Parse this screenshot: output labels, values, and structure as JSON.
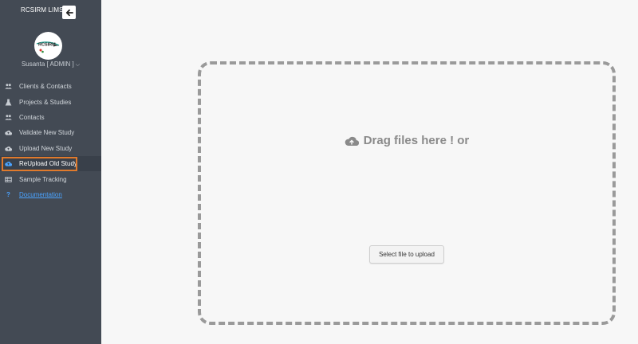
{
  "sidebar": {
    "brand": "RCSIRM LIMS",
    "user": "Susanta [ ADMIN ]",
    "user_caret": "⌵",
    "avatar_text": "RCSIRM",
    "items": [
      {
        "label": "Clients & Contacts",
        "icon": "users-icon"
      },
      {
        "label": "Projects & Studies",
        "icon": "flask-icon"
      },
      {
        "label": "Contacts",
        "icon": "users-icon"
      },
      {
        "label": "Validate New Study",
        "icon": "cloud-upload-icon"
      },
      {
        "label": "Upload New Study",
        "icon": "cloud-upload-icon"
      },
      {
        "label": "ReUpload Old Study",
        "icon": "cloud-upload-icon",
        "active": true
      },
      {
        "label": "Sample Tracking",
        "icon": "table-icon"
      },
      {
        "label": "Documentation",
        "icon": "question-icon",
        "link": true,
        "icon_text": "?"
      }
    ]
  },
  "upload": {
    "drop_text": "Drag files here ! or",
    "button_label": "Select file to upload"
  },
  "colors": {
    "sidebar_bg": "#434a54",
    "highlight": "#e07a2c",
    "link": "#4aa3ff",
    "dropzone_border": "#9a9a9a"
  }
}
